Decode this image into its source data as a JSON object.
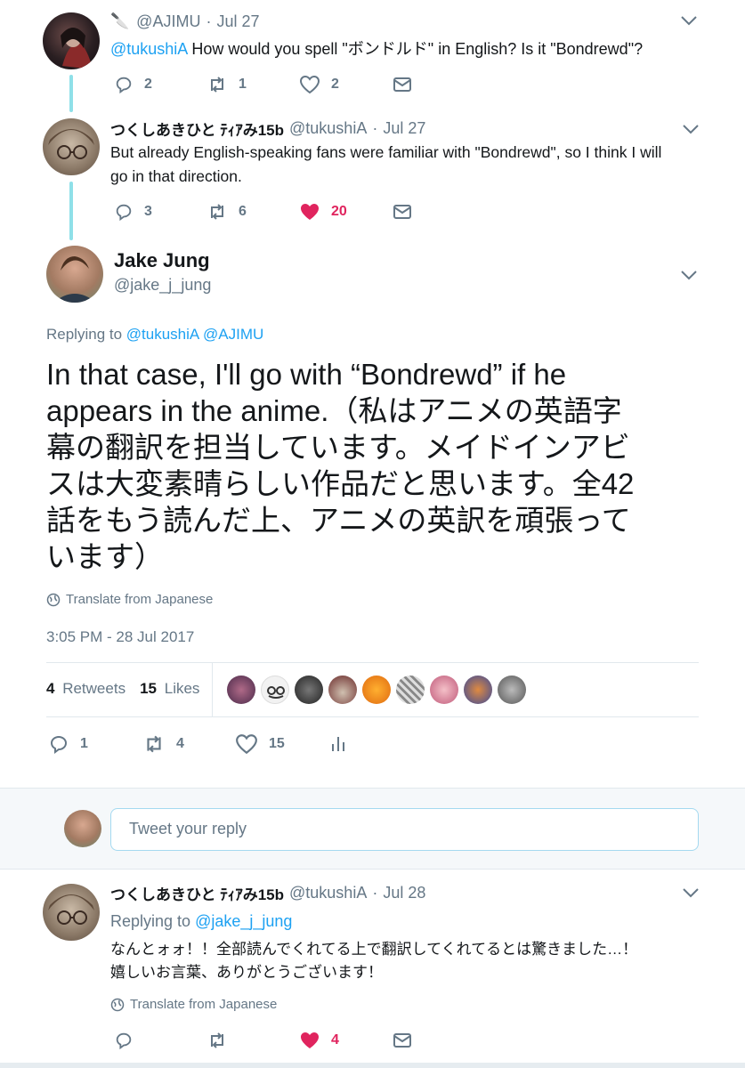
{
  "tweet1": {
    "display_name": "🔪",
    "handle": "@AJIMU",
    "date": "Jul 27",
    "mention": "@tukushiA",
    "text": " How would you spell \"ボンドルド\" in English? Is it \"Bondrewd\"?",
    "replies": "2",
    "retweets": "1",
    "likes": "2"
  },
  "tweet2": {
    "display_name": "つくしあきひと ﾃｨｱみ15b",
    "handle": "@tukushiA",
    "date": "Jul 27",
    "text_line1": "But already English-speaking fans were familiar with \"Bondrewd\", so I think I will",
    "text_line2": "go in that direction.",
    "replies": "3",
    "retweets": "6",
    "likes": "20"
  },
  "main": {
    "display_name": "Jake Jung",
    "handle": "@jake_j_jung",
    "replying_prefix": "Replying to ",
    "replying_to": "@tukushiA @AJIMU",
    "text_lines": [
      "In that case, I'll go with “Bondrewd” if he",
      "appears in the anime.（私はアニメの英語字",
      "幕の翻訳を担当しています。メイドインアビ",
      "スは大変素晴らしい作品だと思います。全42",
      "話をもう読んだ上、アニメの英訳を頑張って",
      "います）"
    ],
    "translate": "Translate from Japanese",
    "timestamp": "3:05 PM - 28 Jul 2017",
    "retweets_count": "4",
    "retweets_label": "Retweets",
    "likes_count": "15",
    "likes_label": "Likes",
    "replies": "1",
    "retweets": "4",
    "likes": "15"
  },
  "composer": {
    "placeholder": "Tweet your reply"
  },
  "reply": {
    "display_name": "つくしあきひと ﾃｨｱみ15b",
    "handle": "@tukushiA",
    "date": "Jul 28",
    "replying_prefix": "Replying to ",
    "replying_to": "@jake_j_jung",
    "text_line1": "なんとォォ！！全部読んでくれてる上で翻訳してくれてるとは驚きました…！",
    "text_line2": "嬉しいお言葉、ありがとうございます！",
    "translate": "Translate from Japanese",
    "likes": "4"
  },
  "colors": {
    "accent": "#1da1f2",
    "like": "#e0245e",
    "muted": "#657786",
    "thread": "#8fe0e8"
  }
}
